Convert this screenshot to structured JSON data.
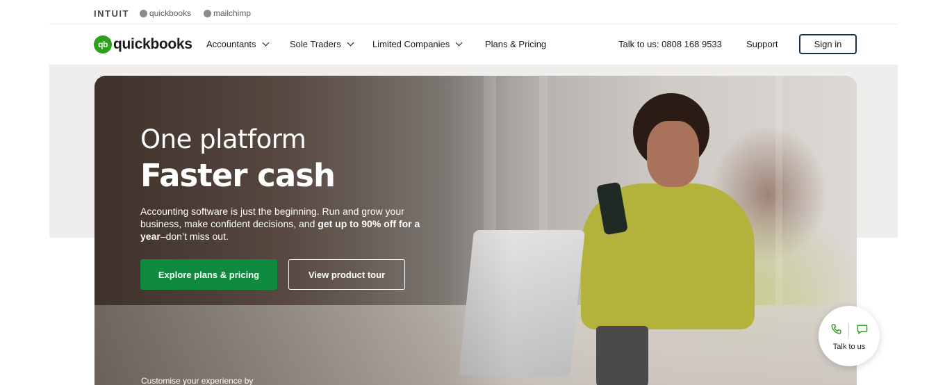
{
  "brands": [
    "INTUIT",
    "quickbooks",
    "mailchimp"
  ],
  "logo": {
    "mark": "qb",
    "text": "quickbooks"
  },
  "nav": {
    "items": [
      {
        "label": "Accountants",
        "dropdown": true
      },
      {
        "label": "Sole Traders",
        "dropdown": true
      },
      {
        "label": "Limited Companies",
        "dropdown": true
      },
      {
        "label": "Plans & Pricing",
        "dropdown": false
      }
    ],
    "phone": "Talk to us: 0808 168 9533",
    "support": "Support",
    "signin": "Sign in"
  },
  "hero": {
    "heading_line1": "One platform",
    "heading_line2": "Faster cash",
    "lead_plain": "Accounting software is just the beginning. Run and grow your business, make confident decisions, and ",
    "lead_bold": "get up to 90% off for a year",
    "lead_tail": "–don’t miss out.",
    "primary_cta": "Explore plans & pricing",
    "secondary_cta": "View product tour",
    "customise": "Customise your experience by"
  },
  "talk_widget": {
    "label": "Talk to us",
    "icons": [
      "phone-icon",
      "chat-icon"
    ]
  },
  "colors": {
    "brand_green": "#2ca01c",
    "cta_green": "#108a3e",
    "signin_border": "#1b3146"
  }
}
